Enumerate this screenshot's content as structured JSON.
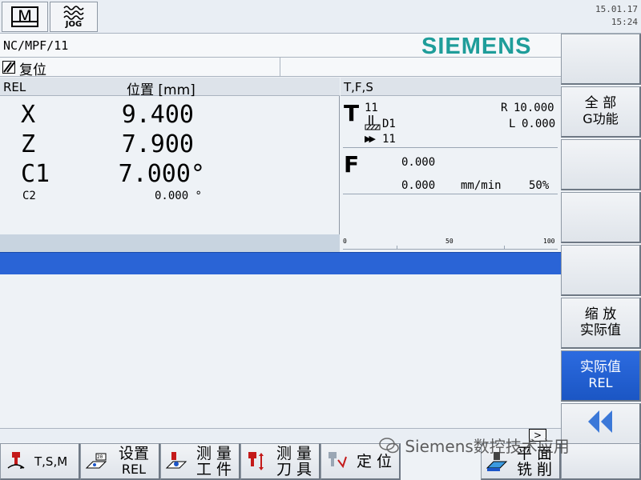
{
  "header": {
    "mode_machine_label": "M",
    "mode_jog_label": "JOG",
    "date": "15.01.17",
    "time": "15:24"
  },
  "program": {
    "path": "NC/MPF/11",
    "brand": "SIEMENS"
  },
  "status": {
    "state": "复位"
  },
  "position": {
    "col_rel": "REL",
    "col_pos": "位置 [mm]",
    "axes": [
      {
        "name": "X",
        "value": "9.400"
      },
      {
        "name": "Z",
        "value": "7.900"
      },
      {
        "name": "C1",
        "value": "7.000°"
      },
      {
        "name": "C2",
        "value": "0.000 °"
      }
    ]
  },
  "tfs": {
    "title": "T,F,S",
    "t_label": "T",
    "t_number": "11",
    "t_d": "D1",
    "t_next": "11",
    "r_label": "R",
    "r_value": "10.000",
    "l_label": "L",
    "l_value": "0.000",
    "f_label": "F",
    "f_value1": "0.000",
    "f_value2": "0.000",
    "f_unit": "mm/min",
    "f_override": "50%",
    "override_fraction": 0.5,
    "scale": [
      "0",
      "50",
      "100"
    ]
  },
  "vertical_softkeys": [
    {
      "line1": "",
      "line2": ""
    },
    {
      "line1": "全 部",
      "line2": "G功能"
    },
    {
      "line1": "",
      "line2": ""
    },
    {
      "line1": "",
      "line2": ""
    },
    {
      "line1": "",
      "line2": ""
    },
    {
      "line1": "缩 放",
      "line2": "实际值"
    },
    {
      "line1": "实际值",
      "line2": "REL"
    },
    {
      "line1": "",
      "line2": ""
    }
  ],
  "horizontal_softkeys": [
    {
      "label": "T,S,M"
    },
    {
      "line1": "设置",
      "line2": "REL"
    },
    {
      "line1": "测 量",
      "line2": "工 件"
    },
    {
      "line1": "测 量",
      "line2": "刀 具"
    },
    {
      "label": "定 位"
    },
    {
      "line1": "平 面",
      "line2": "铣 削"
    },
    {
      "label": ""
    }
  ],
  "watermark": "Siemens数控技术应用",
  "colors": {
    "brand_teal": "#1f9d9a",
    "active_blue": "#2a64d6",
    "background": "#eef2f6"
  }
}
